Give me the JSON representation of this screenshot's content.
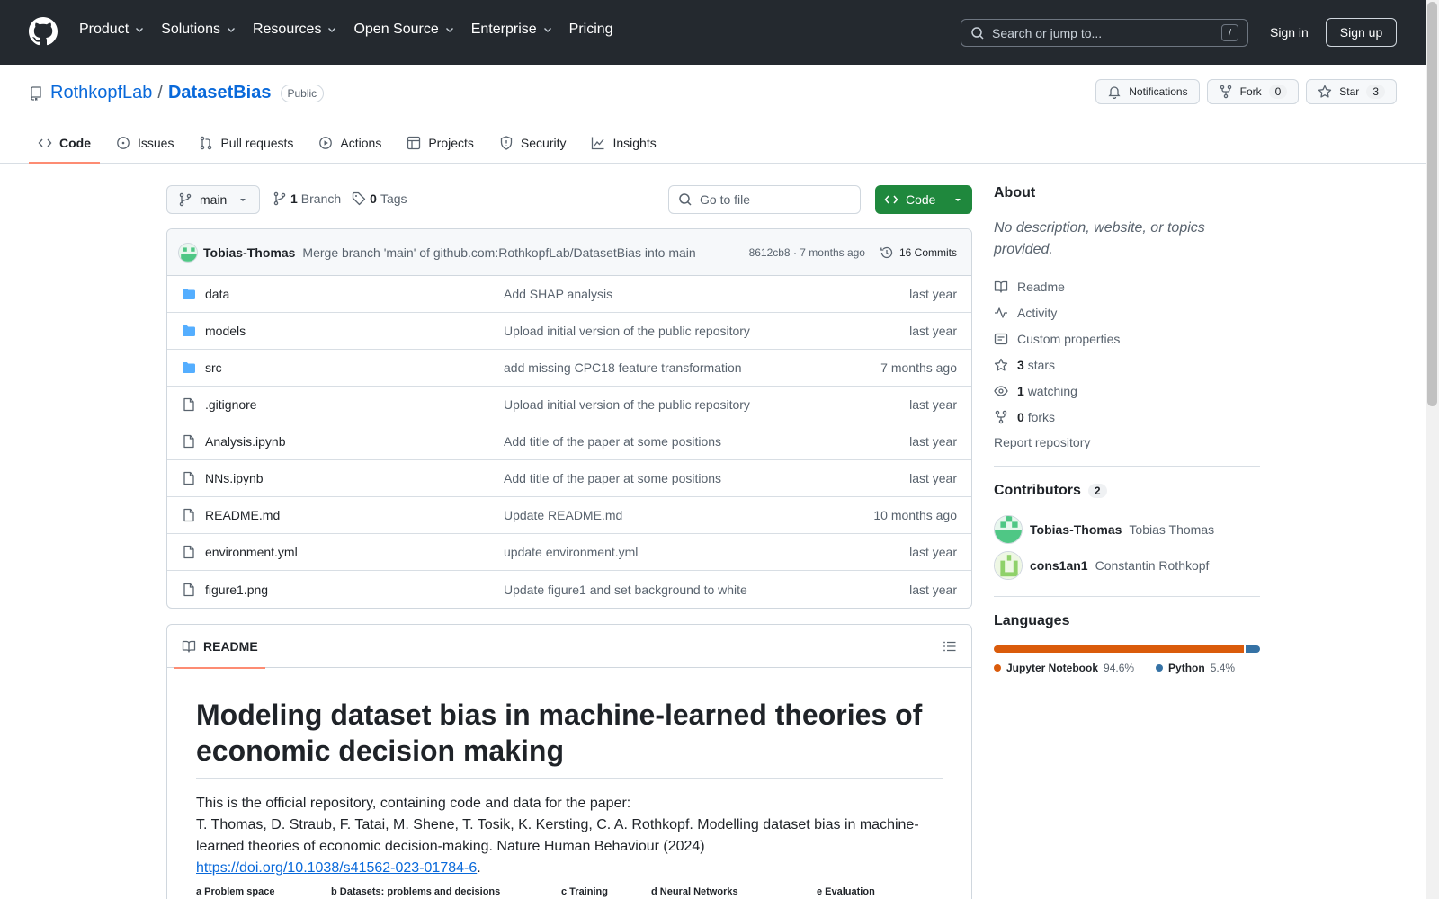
{
  "header": {
    "nav": [
      "Product",
      "Solutions",
      "Resources",
      "Open Source",
      "Enterprise",
      "Pricing"
    ],
    "search_placeholder": "Search or jump to...",
    "search_key": "/",
    "signin": "Sign in",
    "signup": "Sign up"
  },
  "repo": {
    "owner": "RothkopfLab",
    "sep": "/",
    "name": "DatasetBias",
    "visibility": "Public",
    "notifications": "Notifications",
    "fork_label": "Fork",
    "fork_count": "0",
    "star_label": "Star",
    "star_count": "3"
  },
  "tabs": [
    "Code",
    "Issues",
    "Pull requests",
    "Actions",
    "Projects",
    "Security",
    "Insights"
  ],
  "toolbar": {
    "branch": "main",
    "branch_count": "1",
    "branch_label": "Branch",
    "tag_count": "0",
    "tag_label": "Tags",
    "goto_placeholder": "Go to file",
    "code_label": "Code"
  },
  "commit": {
    "author": "Tobias-Thomas",
    "message": "Merge branch 'main' of github.com:RothkopfLab/DatasetBias into main",
    "sha_time": "8612cb8 · 7 months ago",
    "commits": "16 Commits"
  },
  "files": [
    {
      "type": "folder",
      "name": "data",
      "msg": "Add SHAP analysis",
      "date": "last year"
    },
    {
      "type": "folder",
      "name": "models",
      "msg": "Upload initial version of the public repository",
      "date": "last year"
    },
    {
      "type": "folder",
      "name": "src",
      "msg": "add missing CPC18 feature transformation",
      "date": "7 months ago"
    },
    {
      "type": "file",
      "name": ".gitignore",
      "msg": "Upload initial version of the public repository",
      "date": "last year"
    },
    {
      "type": "file",
      "name": "Analysis.ipynb",
      "msg": "Add title of the paper at some positions",
      "date": "last year"
    },
    {
      "type": "file",
      "name": "NNs.ipynb",
      "msg": "Add title of the paper at some positions",
      "date": "last year"
    },
    {
      "type": "file",
      "name": "README.md",
      "msg": "Update README.md",
      "date": "10 months ago"
    },
    {
      "type": "file",
      "name": "environment.yml",
      "msg": "update environment.yml",
      "date": "last year"
    },
    {
      "type": "file",
      "name": "figure1.png",
      "msg": "Update figure1 and set background to white",
      "date": "last year"
    }
  ],
  "readme": {
    "tab": "README",
    "title": "Modeling dataset bias in machine-learned theories of economic decision making",
    "p1": "This is the official repository, containing code and data for the paper:",
    "p2": "T. Thomas, D. Straub, F. Tatai, M. Shene, T. Tosik, K. Kersting, C. A. Rothkopf. Modelling dataset bias in machine-learned theories of economic decision-making. Nature Human Behaviour (2024)",
    "link": "https://doi.org/10.1038/s41562-023-01784-6",
    "link_tail": ".",
    "figure_labels": [
      "a Problem space",
      "b Datasets: problems and decisions",
      "c Training",
      "d Neural Networks",
      "e Evaluation"
    ]
  },
  "about": {
    "title": "About",
    "desc": "No description, website, or topics provided.",
    "readme": "Readme",
    "activity": "Activity",
    "custom": "Custom properties",
    "stars_n": "3",
    "stars": "stars",
    "watching_n": "1",
    "watching": "watching",
    "forks_n": "0",
    "forks": "forks",
    "report": "Report repository"
  },
  "contributors": {
    "title": "Contributors",
    "count": "2",
    "list": [
      {
        "login": "Tobias-Thomas",
        "name": "Tobias Thomas"
      },
      {
        "login": "cons1an1",
        "name": "Constantin Rothkopf"
      }
    ]
  },
  "languages": {
    "title": "Languages",
    "list": [
      {
        "name": "Jupyter Notebook",
        "pct": "94.6%",
        "value": 94.6,
        "color": "#DA5B0B"
      },
      {
        "name": "Python",
        "pct": "5.4%",
        "value": 5.4,
        "color": "#3572A5"
      }
    ]
  }
}
